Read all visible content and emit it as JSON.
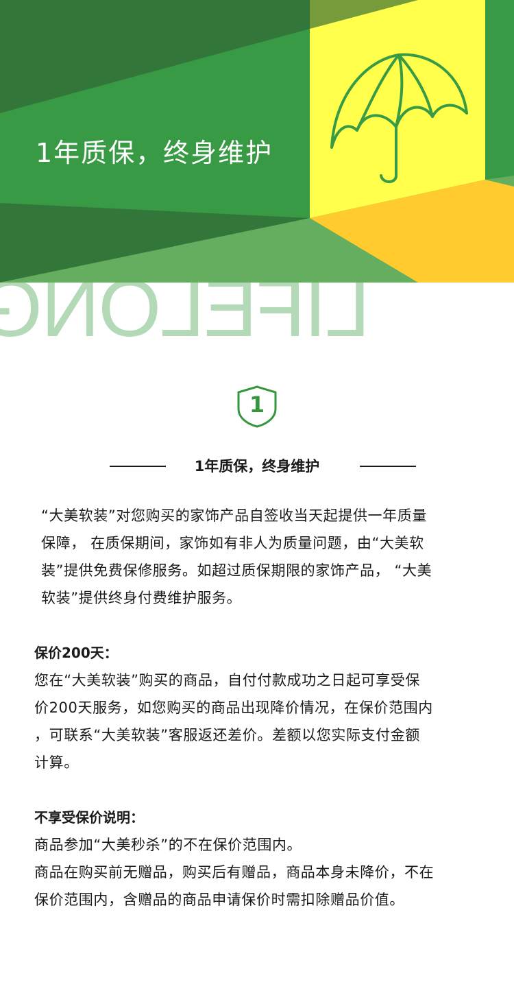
{
  "banner": {
    "title": "1年质保，终身维护",
    "watermark": "LIFELONG",
    "colors": {
      "dark_green": "#33763a",
      "mid_green": "#389a45",
      "light_green": "#66ae5f",
      "olive_green": "#769b3b",
      "yellow": "#ffff4c",
      "orange": "#ffcb2f",
      "umbrella_stroke": "#389a45",
      "watermark": "#b3d9b7"
    },
    "icon": "umbrella-icon"
  },
  "badge": {
    "number": "1",
    "icon": "shield-icon",
    "color": "#36963f"
  },
  "section": {
    "heading": "1年质保，终身维护",
    "intro_lines": [
      "“大美软装”对您购买的家饰产品自签收当天起提供一年质量",
      "保障， 在质保期间，家饰如有非人为质量问题，由“大美软",
      "装”提供免费保修服务。如超过质保期限的家饰产品， “大美",
      "软装”提供终身付费维护服务。"
    ],
    "price_protection": {
      "title": "保价200天：",
      "lines": [
        "您在“大美软装”购买的商品，自付付款成功之日起可享受保",
        "价200天服务，如您购买的商品出现降价情况，在保价范围内",
        "，可联系“大美软装”客服返还差价。差额以您实际支付金额",
        "计算。"
      ]
    },
    "exclusions": {
      "title": "不享受保价说明：",
      "lines": [
        "商品参加“大美秒杀”的不在保价范围内。",
        "商品在购买前无赠品，购买后有赠品，商品本身未降价，不在",
        "保价范围内，含赠品的商品申请保价时需扣除赠品价值。"
      ]
    }
  }
}
